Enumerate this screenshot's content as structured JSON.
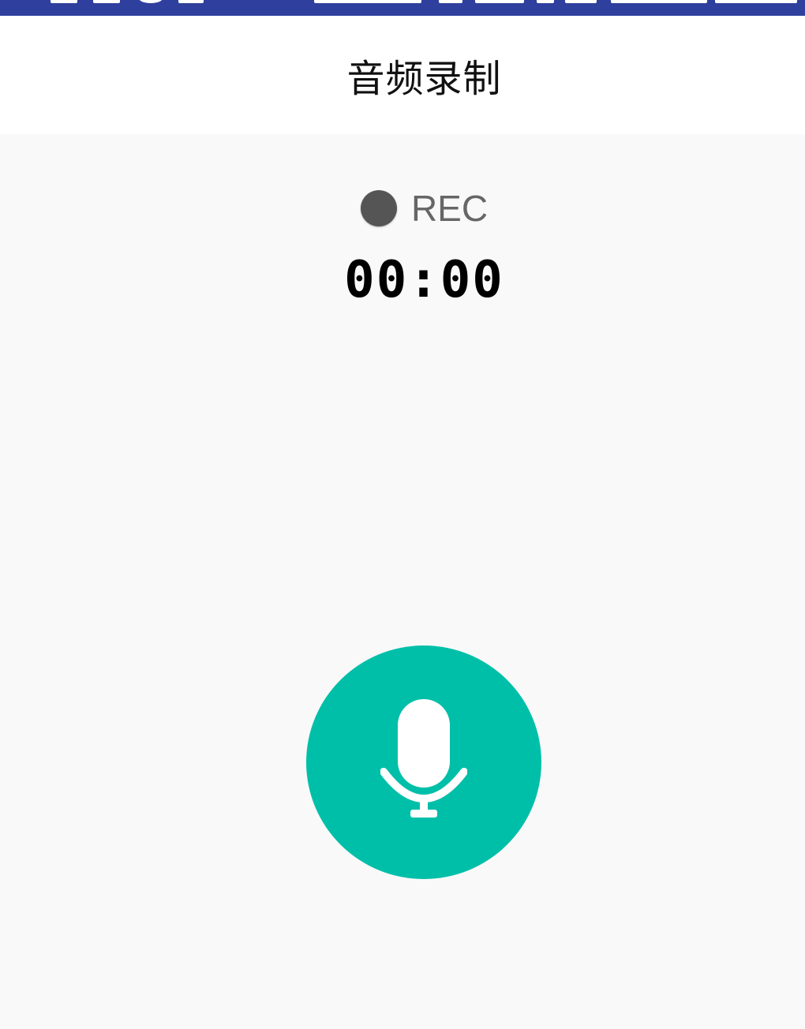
{
  "app_bar": {
    "title": "音频录制"
  },
  "recording": {
    "indicator_label": "REC",
    "indicator_color": "#555555",
    "timer": "00:00"
  },
  "record_button": {
    "icon": "microphone-icon",
    "color": "#00bfa9"
  },
  "theme": {
    "status_bar_color": "#2f3f9e",
    "background_color": "#f9f9f9",
    "app_bar_color": "#ffffff"
  }
}
